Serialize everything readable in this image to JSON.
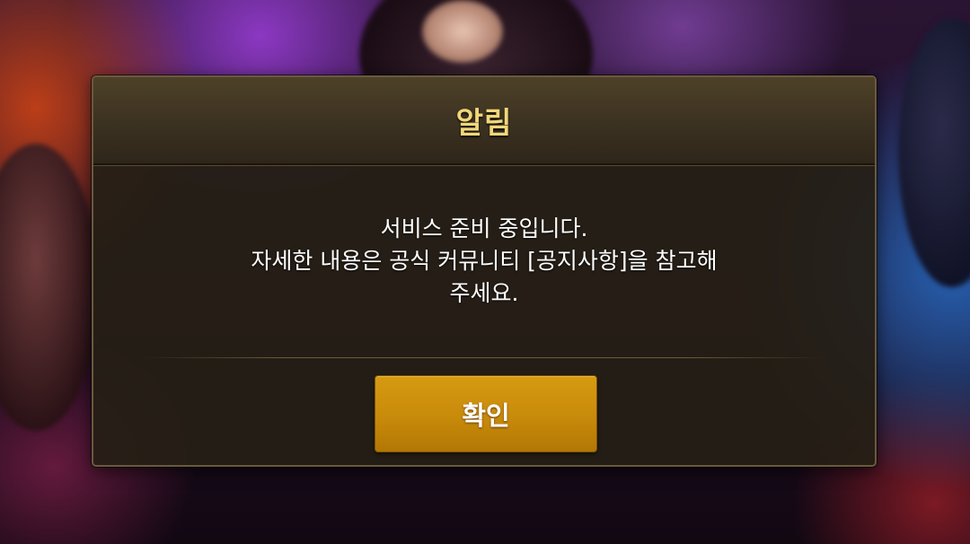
{
  "dialog": {
    "title": "알림",
    "message_lines": [
      "서비스 준비 중입니다.",
      "자세한 내용은 공식 커뮤니티 [공지사항]을 참고해",
      "주세요."
    ],
    "confirm_label": "확인"
  },
  "colors": {
    "title": "#f1d77a",
    "button": "#c88a0a",
    "dialog_background": "#261f16",
    "dialog_border": "#6a5a3d"
  }
}
